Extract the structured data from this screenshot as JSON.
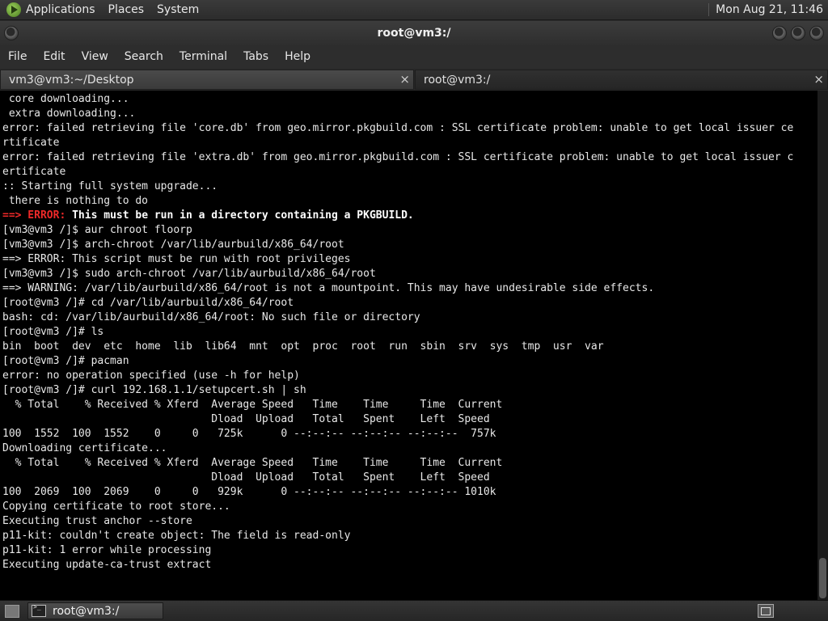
{
  "top_panel": {
    "menus": [
      "Applications",
      "Places",
      "System"
    ],
    "clock": "Mon Aug 21, 11:46"
  },
  "window": {
    "title": "root@vm3:/"
  },
  "menubar": [
    "File",
    "Edit",
    "View",
    "Search",
    "Terminal",
    "Tabs",
    "Help"
  ],
  "tabs": [
    {
      "label": "vm3@vm3:~/Desktop",
      "close": "×"
    },
    {
      "label": "root@vm3:/",
      "close": "×"
    }
  ],
  "terminal": {
    "lines": [
      [
        {
          "t": " core downloading..."
        }
      ],
      [
        {
          "t": " extra downloading..."
        }
      ],
      [
        {
          "t": "error: failed retrieving file 'core.db' from geo.mirror.pkgbuild.com : SSL certificate problem: unable to get local issuer ce"
        }
      ],
      [
        {
          "t": "rtificate"
        }
      ],
      [
        {
          "t": "error: failed retrieving file 'extra.db' from geo.mirror.pkgbuild.com : SSL certificate problem: unable to get local issuer c"
        }
      ],
      [
        {
          "t": "ertificate"
        }
      ],
      [
        {
          "t": ":: Starting full system upgrade..."
        }
      ],
      [
        {
          "t": " there is nothing to do"
        }
      ],
      [
        {
          "t": "==> ERROR:",
          "s": "red"
        },
        {
          "t": " This must be run in a directory containing a PKGBUILD.",
          "s": "bold"
        }
      ],
      [
        {
          "t": "[vm3@vm3 /]$ aur chroot floorp"
        }
      ],
      [
        {
          "t": "[vm3@vm3 /]$ arch-chroot /var/lib/aurbuild/x86_64/root"
        }
      ],
      [
        {
          "t": "==> ERROR: This script must be run with root privileges"
        }
      ],
      [
        {
          "t": "[vm3@vm3 /]$ sudo arch-chroot /var/lib/aurbuild/x86_64/root"
        }
      ],
      [
        {
          "t": "==> WARNING: /var/lib/aurbuild/x86_64/root is not a mountpoint. This may have undesirable side effects."
        }
      ],
      [
        {
          "t": "[root@vm3 /]# cd /var/lib/aurbuild/x86_64/root"
        }
      ],
      [
        {
          "t": "bash: cd: /var/lib/aurbuild/x86_64/root: No such file or directory"
        }
      ],
      [
        {
          "t": "[root@vm3 /]# ls"
        }
      ],
      [
        {
          "t": "bin  boot  dev  etc  home  lib  lib64  mnt  opt  proc  root  run  sbin  srv  sys  tmp  usr  var"
        }
      ],
      [
        {
          "t": "[root@vm3 /]# pacman"
        }
      ],
      [
        {
          "t": "error: no operation specified (use -h for help)"
        }
      ],
      [
        {
          "t": "[root@vm3 /]# curl 192.168.1.1/setupcert.sh | sh"
        }
      ],
      [
        {
          "t": "  % Total    % Received % Xferd  Average Speed   Time    Time     Time  Current"
        }
      ],
      [
        {
          "t": "                                 Dload  Upload   Total   Spent    Left  Speed"
        }
      ],
      [
        {
          "t": "100  1552  100  1552    0     0   725k      0 --:--:-- --:--:-- --:--:--  757k"
        }
      ],
      [
        {
          "t": "Downloading certificate..."
        }
      ],
      [
        {
          "t": "  % Total    % Received % Xferd  Average Speed   Time    Time     Time  Current"
        }
      ],
      [
        {
          "t": "                                 Dload  Upload   Total   Spent    Left  Speed"
        }
      ],
      [
        {
          "t": "100  2069  100  2069    0     0   929k      0 --:--:-- --:--:-- --:--:-- 1010k"
        }
      ],
      [
        {
          "t": "Copying certificate to root store..."
        }
      ],
      [
        {
          "t": "Executing trust anchor --store"
        }
      ],
      [
        {
          "t": "p11-kit: couldn't create object: The field is read-only"
        }
      ],
      [
        {
          "t": "p11-kit: 1 error while processing"
        }
      ],
      [
        {
          "t": "Executing update-ca-trust extract"
        }
      ]
    ]
  },
  "taskbar": {
    "task_label": "root@vm3:/"
  },
  "icons": {
    "apps": "applications-icon",
    "terminal": "terminal-icon",
    "workspace": "workspace-switcher-icon",
    "show_desktop": "show-desktop-icon"
  }
}
